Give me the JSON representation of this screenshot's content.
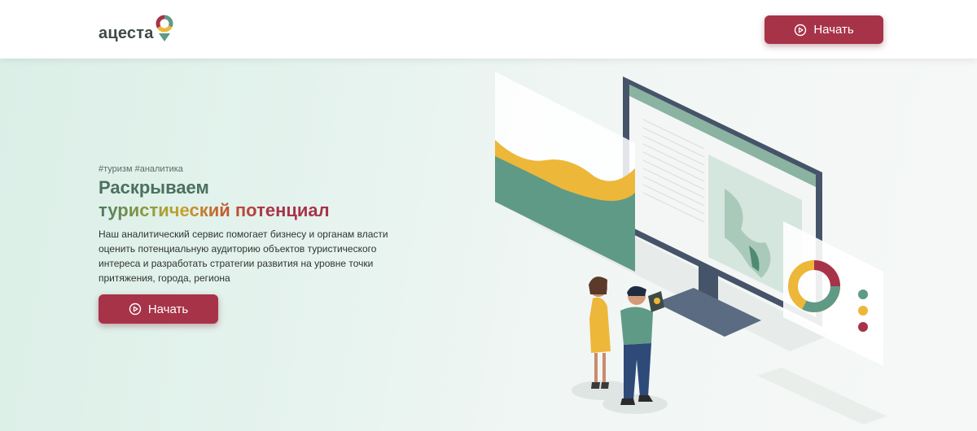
{
  "header": {
    "logo_text": "ацеста",
    "start_button_label": "Начать"
  },
  "hero": {
    "tags": "#туризм #аналитика",
    "title_line1": "Раскрываем",
    "title_line2": "туристический потенциал",
    "description": "Наш аналитический сервис помогает бизнесу и органам власти оценить потенциальную аудиторию объектов туристического интереса и разработать стратегии развития на уровне точки притяжения, города, региона",
    "start_button_label": "Начать"
  },
  "colors": {
    "brand_red": "#a73348",
    "brand_green": "#5f9a87",
    "brand_yellow": "#edb73a",
    "text_dark": "#3e4a45"
  },
  "icons": [
    "logo-pin-icon",
    "play-circle-icon",
    "analytics-illustration"
  ]
}
